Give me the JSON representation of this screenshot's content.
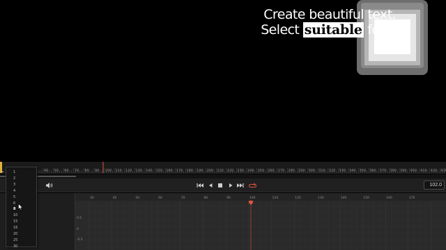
{
  "title_text": {
    "line1": "Create beautiful text.",
    "line2_before": "Select ",
    "line2_highlight": "suitable",
    "line2_after": " font."
  },
  "ruler": {
    "labels": [
      "40",
      "50",
      "60",
      "70",
      "80",
      "90",
      "100",
      "110",
      "120",
      "130",
      "140",
      "150",
      "160",
      "170",
      "180",
      "190",
      "200",
      "210",
      "220",
      "230",
      "240",
      "250",
      "260",
      "270",
      "280",
      "290",
      "300",
      "310",
      "320",
      "330",
      "340",
      "350",
      "360",
      "370",
      "380",
      "390",
      "400",
      "410",
      "420",
      "430"
    ]
  },
  "progress": {
    "fraction": 0.17
  },
  "transport": {
    "icons": {
      "volume": "volume-icon",
      "first": "skip-to-start-icon",
      "prev": "step-back-icon",
      "stop": "stop-icon",
      "play": "play-icon",
      "last": "skip-to-end-icon",
      "loop": "loop-icon"
    },
    "time_value": "102.0",
    "loop_color": "#e0533c"
  },
  "fps_dropdown": {
    "options": [
      "1",
      "2",
      "3",
      "4",
      "5",
      "6",
      "8",
      "10",
      "15",
      "16",
      "20",
      "25",
      "30"
    ],
    "selected": "1",
    "highlighted": "8"
  },
  "graph": {
    "x_labels": [
      "30",
      "40",
      "50",
      "60",
      "70",
      "80",
      "90",
      "100",
      "110",
      "120",
      "130",
      "140",
      "150",
      "160",
      "170"
    ],
    "y_labels": [
      "0.5",
      "0",
      "-0.5"
    ],
    "playhead_color": "#e0533c"
  }
}
